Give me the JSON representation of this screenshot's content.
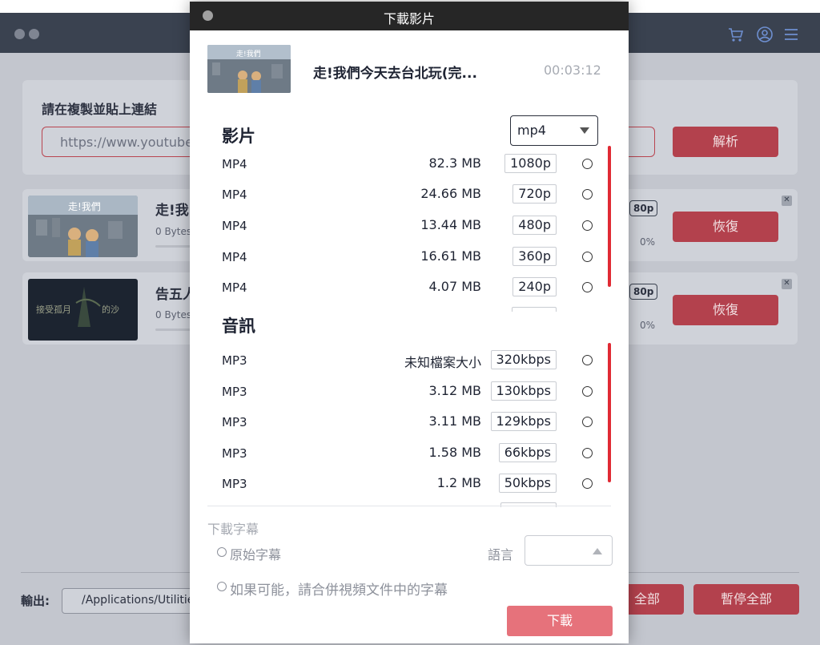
{
  "background": {
    "paste_label": "請在複製並貼上連結",
    "url_value": "https://www.youtube.",
    "parse_button": "解析",
    "items": [
      {
        "title": "走!我",
        "bytes": "0 Bytes",
        "quality": "80p",
        "resume": "恢復",
        "percent": "0%"
      },
      {
        "title": "告五人",
        "bytes": "0 Bytes",
        "quality": "80p",
        "resume": "恢復",
        "percent": "0%"
      }
    ],
    "output_label": "輸出:",
    "output_path": "/Applications/Utilitie",
    "resume_all_fragment": "全部",
    "pause_all": "暫停全部",
    "toolbar_icons": [
      "cart-icon",
      "user-icon",
      "menu-icon"
    ]
  },
  "dialog": {
    "title": "下載影片",
    "video_title": "走!我們今天去台北玩(完...",
    "duration": "00:03:12",
    "video_section": "影片",
    "format_select": "mp4",
    "video_options": [
      {
        "type": "MP4",
        "size": "82.3 MB",
        "quality": "1080p"
      },
      {
        "type": "MP4",
        "size": "24.66 MB",
        "quality": "720p"
      },
      {
        "type": "MP4",
        "size": "13.44 MB",
        "quality": "480p"
      },
      {
        "type": "MP4",
        "size": "16.61 MB",
        "quality": "360p"
      },
      {
        "type": "MP4",
        "size": "4.07 MB",
        "quality": "240p"
      }
    ],
    "audio_section": "音訊",
    "audio_options": [
      {
        "type": "MP3",
        "size": "未知檔案大小",
        "quality": "320kbps"
      },
      {
        "type": "MP3",
        "size": "3.12 MB",
        "quality": "130kbps"
      },
      {
        "type": "MP3",
        "size": "3.11 MB",
        "quality": "129kbps"
      },
      {
        "type": "MP3",
        "size": "1.58 MB",
        "quality": "66kbps"
      },
      {
        "type": "MP3",
        "size": "1.2 MB",
        "quality": "50kbps"
      }
    ],
    "subtitle_section": "下載字幕",
    "original_subtitle": "原始字幕",
    "language_label": "語言",
    "merge_subtitle": "如果可能，請合併視頻文件中的字幕",
    "download_button": "下載"
  },
  "colors": {
    "accent": "#e6727b",
    "scrollbar": "#e02a34",
    "dark_bar": "#262626"
  }
}
